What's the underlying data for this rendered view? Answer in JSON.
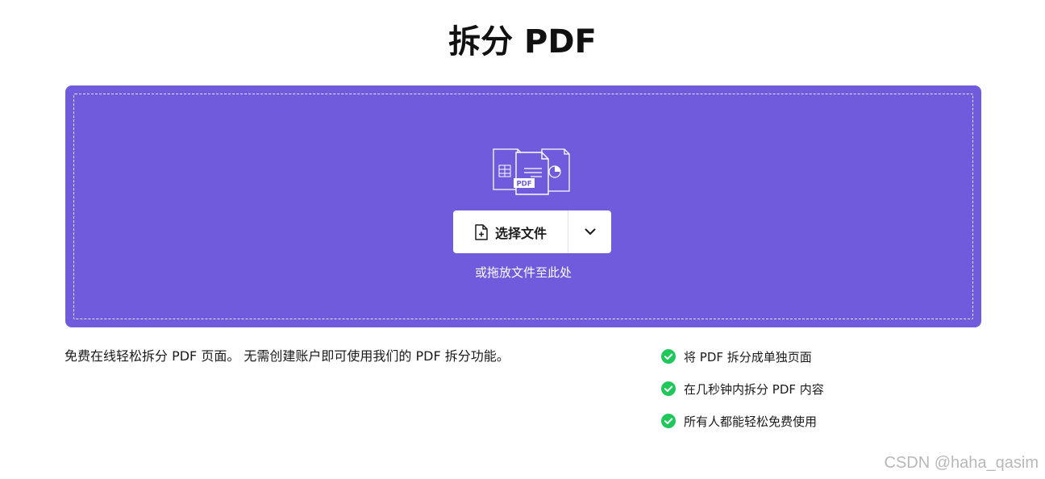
{
  "header": {
    "title": "拆分 PDF"
  },
  "dropzone": {
    "select_button_label": "选择文件",
    "drop_hint": "或拖放文件至此处",
    "pdf_badge": "PDF",
    "background_color": "#6f5bdc"
  },
  "description": {
    "text": "免费在线轻松拆分 PDF 页面。 无需创建账户即可使用我们的 PDF 拆分功能。"
  },
  "features": {
    "check_color": "#1ec85a",
    "items": [
      {
        "label": "将 PDF 拆分成单独页面"
      },
      {
        "label": "在几秒钟内拆分 PDF 内容"
      },
      {
        "label": "所有人都能轻松免费使用"
      }
    ]
  },
  "watermark": {
    "text": "CSDN @haha_qasim"
  },
  "icons": {
    "files_illustration": "files-illustration-icon",
    "add_file": "add-file-icon",
    "chevron": "chevron-down-icon",
    "check": "check-circle-icon"
  }
}
